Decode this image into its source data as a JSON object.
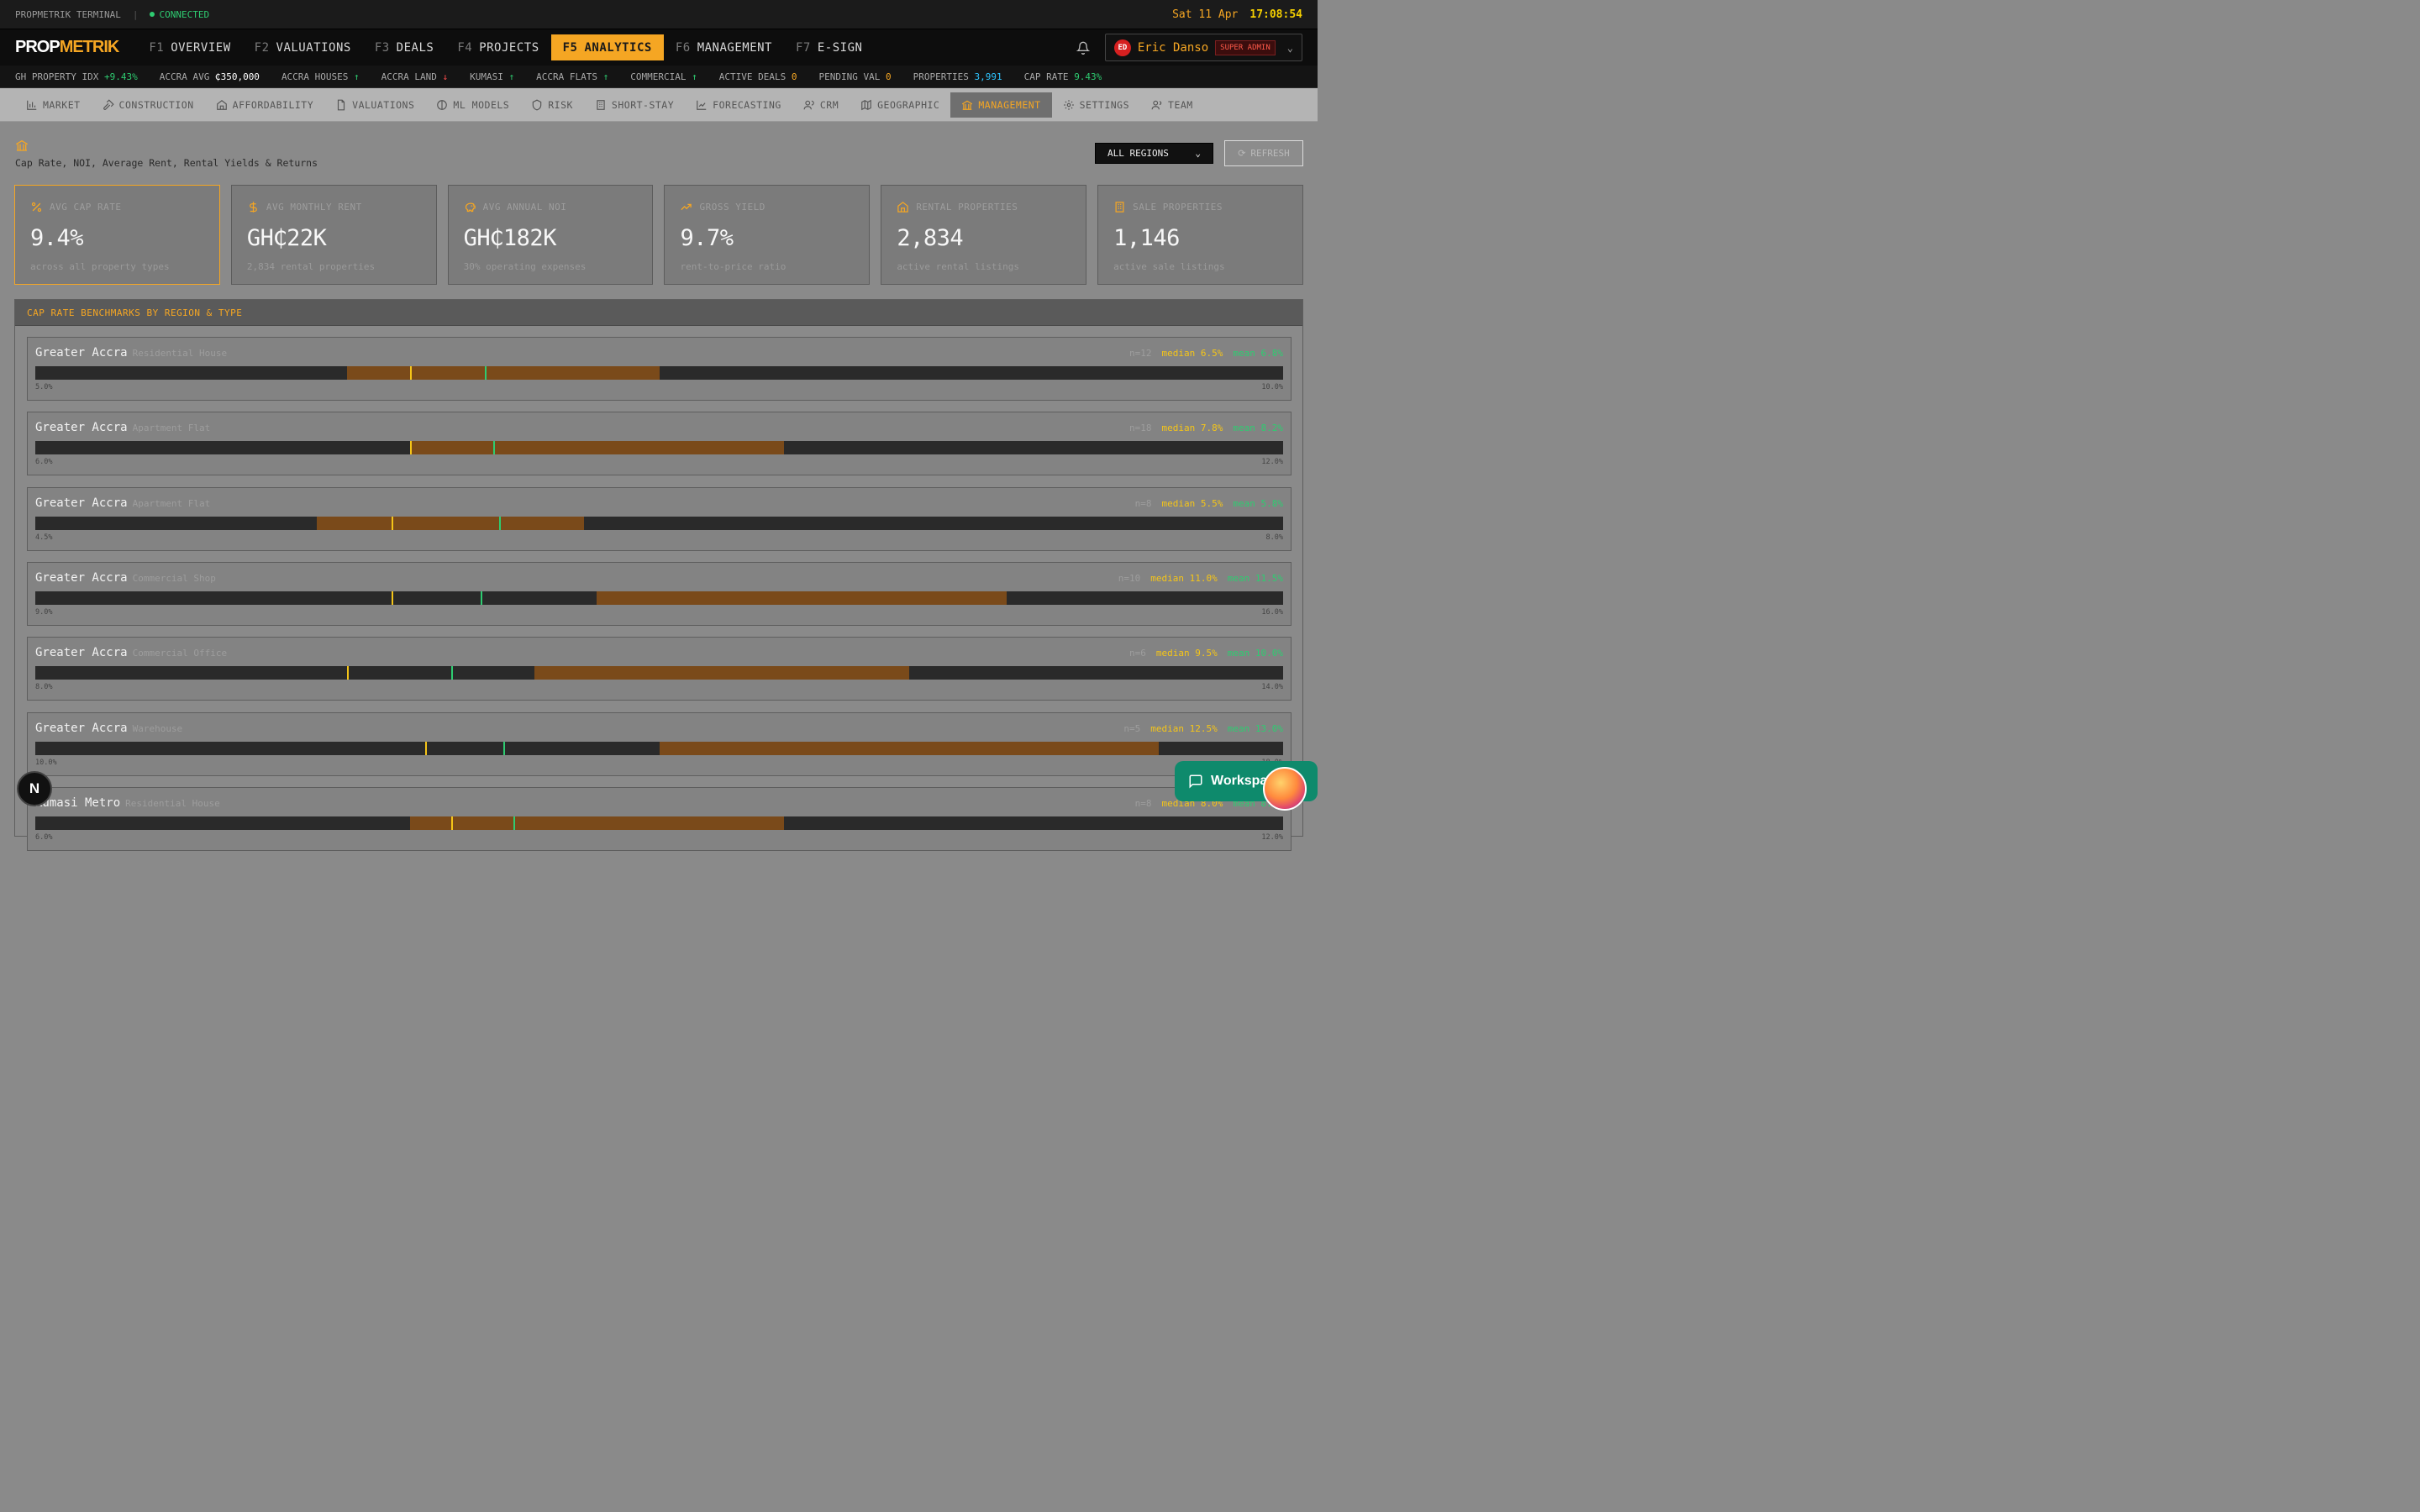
{
  "topbar": {
    "terminal": "PROPMETRIK TERMINAL",
    "status": "CONNECTED",
    "date": "Sat 11 Apr",
    "time": "17:08:54"
  },
  "logo": {
    "part1": "PROP",
    "part2": "METRIK"
  },
  "nav": [
    {
      "key": "F1",
      "label": "OVERVIEW"
    },
    {
      "key": "F2",
      "label": "VALUATIONS"
    },
    {
      "key": "F3",
      "label": "DEALS"
    },
    {
      "key": "F4",
      "label": "PROJECTS"
    },
    {
      "key": "F5",
      "label": "ANALYTICS",
      "active": true
    },
    {
      "key": "F6",
      "label": "MANAGEMENT"
    },
    {
      "key": "F7",
      "label": "E-SIGN"
    }
  ],
  "user": {
    "initials": "ED",
    "name": "Eric Danso",
    "role": "SUPER ADMIN"
  },
  "ticker": [
    {
      "label": "GH PROPERTY IDX",
      "value": "+9.43%",
      "color": "g"
    },
    {
      "label": "ACCRA AVG",
      "value": "₵350,000",
      "color": "w"
    },
    {
      "label": "ACCRA HOUSES",
      "value": "↑",
      "color": "g"
    },
    {
      "label": "ACCRA LAND",
      "value": "↓",
      "color": "r"
    },
    {
      "label": "KUMASI",
      "value": "↑",
      "color": "g"
    },
    {
      "label": "ACCRA FLATS",
      "value": "↑",
      "color": "g"
    },
    {
      "label": "COMMERCIAL",
      "value": "↑",
      "color": "g"
    },
    {
      "label": "ACTIVE DEALS",
      "value": "0",
      "color": "o"
    },
    {
      "label": "PENDING VAL",
      "value": "0",
      "color": "o"
    },
    {
      "label": "PROPERTIES",
      "value": "3,991",
      "color": "c"
    },
    {
      "label": "CAP RATE",
      "value": "9.43%",
      "color": "g"
    }
  ],
  "subnav": [
    {
      "label": "MARKET",
      "icon": "bar-chart-icon"
    },
    {
      "label": "CONSTRUCTION",
      "icon": "hammer-icon"
    },
    {
      "label": "AFFORDABILITY",
      "icon": "home-icon"
    },
    {
      "label": "VALUATIONS",
      "icon": "document-icon"
    },
    {
      "label": "ML MODELS",
      "icon": "brain-icon"
    },
    {
      "label": "RISK",
      "icon": "shield-icon"
    },
    {
      "label": "SHORT-STAY",
      "icon": "building-icon"
    },
    {
      "label": "FORECASTING",
      "icon": "trend-icon"
    },
    {
      "label": "CRM",
      "icon": "users-icon"
    },
    {
      "label": "GEOGRAPHIC",
      "icon": "map-icon"
    },
    {
      "label": "MANAGEMENT",
      "icon": "bank-icon",
      "active": true
    },
    {
      "label": "SETTINGS",
      "icon": "gear-icon"
    },
    {
      "label": "TEAM",
      "icon": "team-icon"
    }
  ],
  "page": {
    "subtitle": "Cap Rate, NOI, Average Rent, Rental Yields & Returns",
    "region": "ALL REGIONS",
    "refresh": "REFRESH"
  },
  "kpis": [
    {
      "label": "AVG CAP RATE",
      "value": "9.4%",
      "sub": "across all property types",
      "icon": "percent-icon"
    },
    {
      "label": "AVG MONTHLY RENT",
      "value": "GH₵22K",
      "sub": "2,834 rental properties",
      "icon": "dollar-icon"
    },
    {
      "label": "AVG ANNUAL NOI",
      "value": "GH₵182K",
      "sub": "30% operating expenses",
      "icon": "piggy-bank-icon"
    },
    {
      "label": "GROSS YIELD",
      "value": "9.7%",
      "sub": "rent-to-price ratio",
      "icon": "trending-up-icon"
    },
    {
      "label": "RENTAL PROPERTIES",
      "value": "2,834",
      "sub": "active rental listings",
      "icon": "house-icon"
    },
    {
      "label": "SALE PROPERTIES",
      "value": "1,146",
      "sub": "active sale listings",
      "icon": "building-icon"
    }
  ],
  "panel": {
    "title": "CAP RATE BENCHMARKS BY REGION & TYPE"
  },
  "chart_data": {
    "type": "range",
    "title": "CAP RATE BENCHMARKS BY REGION & TYPE",
    "rows": [
      {
        "region": "Greater Accra",
        "type": "Residential House",
        "n": "n=12",
        "median": 6.5,
        "mean": 6.8,
        "median_label": "median 6.5%",
        "mean_label": "mean 6.8%",
        "min": 5.0,
        "max": 10.0,
        "min_label": "5.0%",
        "max_label": "10.0%",
        "low": 6.25,
        "high": 7.5
      },
      {
        "region": "Greater Accra",
        "type": "Apartment Flat",
        "n": "n=18",
        "median": 7.8,
        "mean": 8.2,
        "median_label": "median 7.8%",
        "mean_label": "mean 8.2%",
        "min": 6.0,
        "max": 12.0,
        "min_label": "6.0%",
        "max_label": "12.0%",
        "low": 7.8,
        "high": 9.6
      },
      {
        "region": "Greater Accra",
        "type": "Apartment Flat",
        "n": "n=8",
        "median": 5.5,
        "mean": 5.8,
        "median_label": "median 5.5%",
        "mean_label": "mean 5.8%",
        "min": 4.5,
        "max": 8.0,
        "min_label": "4.5%",
        "max_label": "8.0%",
        "low": 5.29,
        "high": 6.04
      },
      {
        "region": "Greater Accra",
        "type": "Commercial Shop",
        "n": "n=10",
        "median": 11.0,
        "mean": 11.5,
        "median_label": "median 11.0%",
        "mean_label": "mean 11.5%",
        "min": 9.0,
        "max": 16.0,
        "min_label": "9.0%",
        "max_label": "16.0%",
        "low": 12.15,
        "high": 14.45
      },
      {
        "region": "Greater Accra",
        "type": "Commercial Office",
        "n": "n=6",
        "median": 9.5,
        "mean": 10.0,
        "median_label": "median 9.5%",
        "mean_label": "mean 10.0%",
        "min": 8.0,
        "max": 14.0,
        "min_label": "8.0%",
        "max_label": "14.0%",
        "low": 10.4,
        "high": 12.2
      },
      {
        "region": "Greater Accra",
        "type": "Warehouse",
        "n": "n=5",
        "median": 12.5,
        "mean": 13.0,
        "median_label": "median 12.5%",
        "mean_label": "mean 13.0%",
        "min": 10.0,
        "max": 18.0,
        "min_label": "10.0%",
        "max_label": "18.0%",
        "low": 14.0,
        "high": 17.2
      },
      {
        "region": "Kumasi Metro",
        "type": "Residential House",
        "n": "n=8",
        "median": 8.0,
        "mean": 8.3,
        "median_label": "median 8.0%",
        "mean_label": "mean 8.3%",
        "min": 6.0,
        "max": 12.0,
        "min_label": "6.0%",
        "max_label": "12.0%",
        "low": 7.8,
        "high": 9.6
      }
    ]
  },
  "workspace": {
    "label": "Workspace"
  },
  "next": {
    "label": "N"
  }
}
